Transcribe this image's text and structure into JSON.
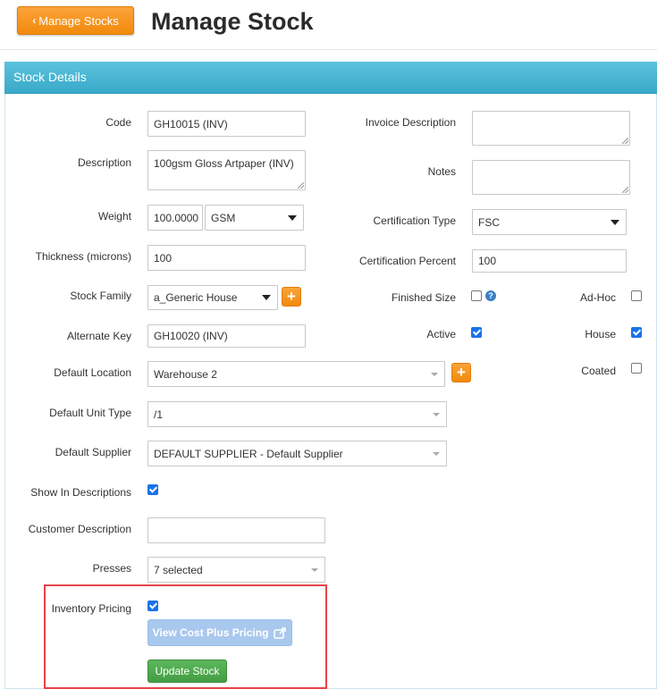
{
  "header": {
    "back_label": "Manage Stocks",
    "title": "Manage Stock"
  },
  "panel": {
    "title": "Stock Details"
  },
  "left": {
    "code": {
      "label": "Code",
      "value": "GH10015 (INV)"
    },
    "description": {
      "label": "Description",
      "value": "100gsm Gloss Artpaper (INV)"
    },
    "weight": {
      "label": "Weight",
      "value": "100.0000",
      "unit": "GSM"
    },
    "thickness": {
      "label": "Thickness (microns)",
      "value": "100"
    },
    "stock_family": {
      "label": "Stock Family",
      "value": "a_Generic House"
    },
    "alternate_key": {
      "label": "Alternate Key",
      "value": "GH10020 (INV)"
    },
    "default_location": {
      "label": "Default Location",
      "value": "Warehouse 2"
    },
    "default_unit_type": {
      "label": "Default Unit Type",
      "value": "/1"
    },
    "default_supplier": {
      "label": "Default Supplier",
      "value": "DEFAULT SUPPLIER - Default Supplier"
    },
    "show_in_descriptions": {
      "label": "Show In Descriptions",
      "checked": true
    },
    "customer_description": {
      "label": "Customer Description",
      "value": ""
    },
    "presses": {
      "label": "Presses",
      "value": "7 selected"
    },
    "inventory_pricing": {
      "label": "Inventory Pricing",
      "checked": true
    }
  },
  "right": {
    "invoice_description": {
      "label": "Invoice Description",
      "value": ""
    },
    "notes": {
      "label": "Notes",
      "value": ""
    },
    "certification_type": {
      "label": "Certification Type",
      "value": "FSC"
    },
    "certification_percent": {
      "label": "Certification Percent",
      "value": "100"
    },
    "finished_size": {
      "label": "Finished Size",
      "checked": false
    },
    "ad_hoc": {
      "label": "Ad-Hoc",
      "checked": false
    },
    "active": {
      "label": "Active",
      "checked": true
    },
    "house": {
      "label": "House",
      "checked": true
    },
    "coated": {
      "label": "Coated",
      "checked": false
    }
  },
  "buttons": {
    "view_cost_plus": "View Cost Plus Pricing",
    "update_stock": "Update Stock"
  },
  "colors": {
    "accent_orange": "#f39314",
    "header_blue": "#45b2d1",
    "success_green": "#4cae4c",
    "highlight_red": "#e8424a"
  }
}
